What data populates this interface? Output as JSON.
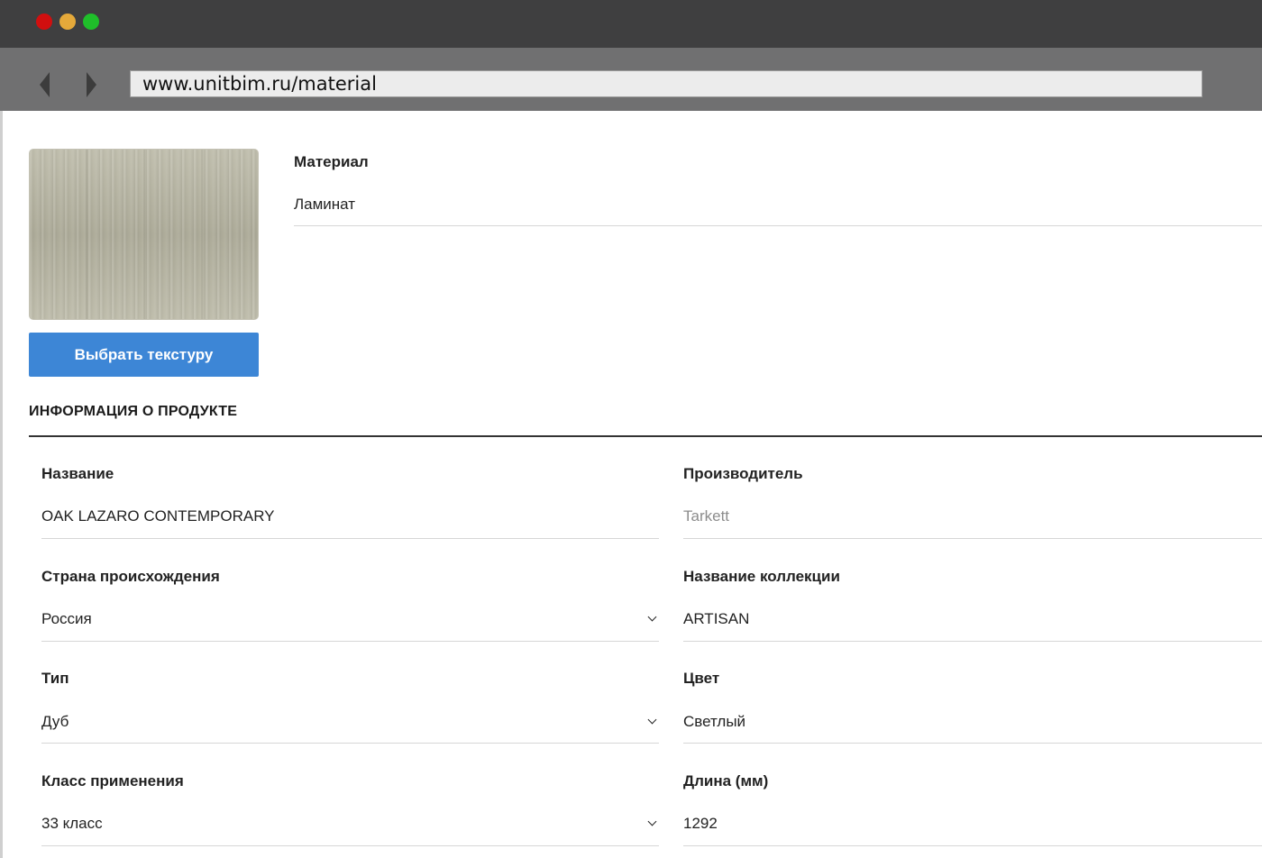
{
  "browser": {
    "url": "www.unitbim.ru/material"
  },
  "material": {
    "label": "Материал",
    "value": "Ламинат"
  },
  "texture_button_label": "Выбрать текстуру",
  "section_title": "ИНФОРМАЦИЯ О ПРОДУКТЕ",
  "fields": {
    "name": {
      "label": "Название",
      "value": "OAK LAZARO CONTEMPORARY"
    },
    "manufacturer": {
      "label": "Производитель",
      "value": "Tarkett"
    },
    "country": {
      "label": "Страна происхождения",
      "value": "Россия"
    },
    "collection": {
      "label": "Название коллекции",
      "value": "ARTISAN"
    },
    "type": {
      "label": "Тип",
      "value": "Дуб"
    },
    "color": {
      "label": "Цвет",
      "value": "Светлый"
    },
    "usage_class": {
      "label": "Класс применения",
      "value": "33 класс"
    },
    "length": {
      "label": "Длина (мм)",
      "value": "1292"
    }
  },
  "icons": {
    "back": "chevron-left-icon",
    "forward": "chevron-right-icon",
    "dropdown": "chevron-down-icon"
  },
  "colors": {
    "accent": "#3d86d6",
    "titlebar": "#3f3f40",
    "navbar": "#707071",
    "window_close": "#d10f0f",
    "window_minimize": "#e5a93a",
    "window_maximize": "#1fbf2a"
  }
}
